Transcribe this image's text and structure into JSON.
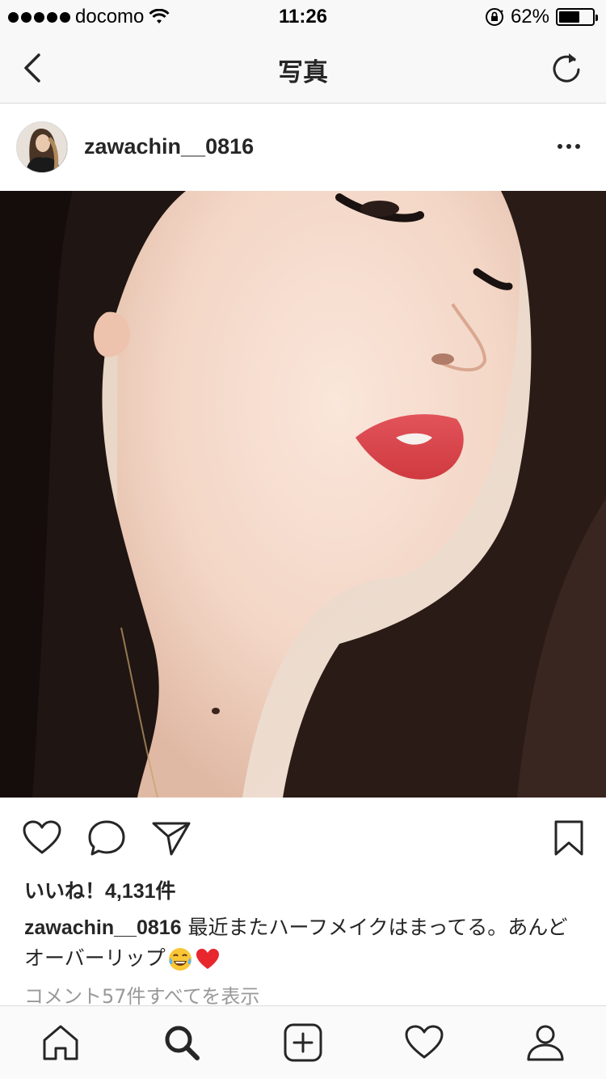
{
  "status_bar": {
    "carrier": "docomo",
    "time": "11:26",
    "battery_percent_text": "62%",
    "battery_level": 0.62,
    "icons": [
      "signal-dots-icon",
      "wifi-icon",
      "rotation-lock-icon",
      "battery-icon"
    ]
  },
  "nav": {
    "title": "写真",
    "back_icon": "chevron-left-icon",
    "refresh_icon": "refresh-icon"
  },
  "post": {
    "username": "zawachin__0816",
    "more_icon": "ellipsis-icon",
    "likes_text": "いいね！4,131件",
    "caption_user": "zawachin__0816",
    "caption_text": " 最近またハーフメイクはまってる。あんどオーバーリップ",
    "caption_emojis": [
      "face-with-tears-of-joy-emoji",
      "red-heart-emoji"
    ],
    "comments_link": "コメント57件すべてを表示"
  },
  "actions": [
    "heart-icon",
    "comment-icon",
    "share-icon",
    "bookmark-icon"
  ],
  "tab_bar": [
    "home-icon",
    "search-icon",
    "add-post-icon",
    "activity-heart-icon",
    "profile-icon"
  ],
  "colors": {
    "text": "#262626",
    "muted": "#999999",
    "bar_bg": "#f8f8f8",
    "heart_red": "#e0245e"
  }
}
